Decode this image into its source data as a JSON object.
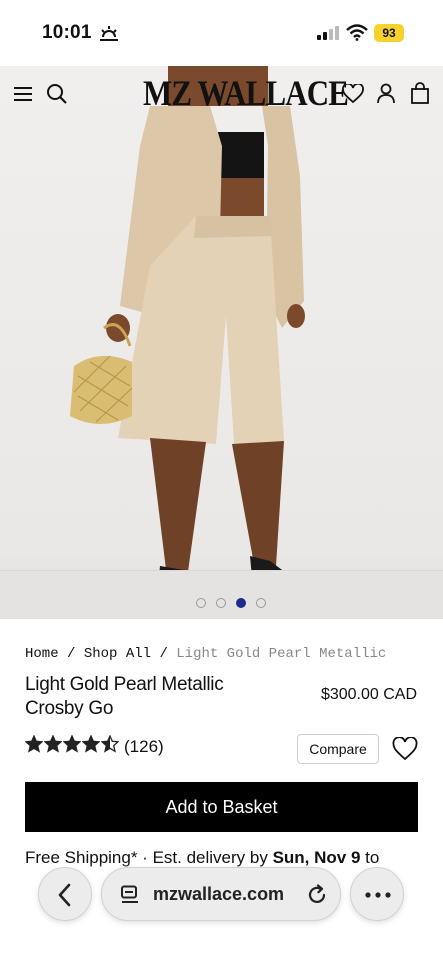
{
  "status_bar": {
    "time": "10:01",
    "battery": "93"
  },
  "header": {
    "logo": "MZ WALLACE",
    "icons": [
      "menu-icon",
      "search-icon",
      "heart-icon",
      "account-icon",
      "bag-icon"
    ]
  },
  "gallery": {
    "dots": 4,
    "active_index": 2
  },
  "breadcrumb": {
    "home": "Home",
    "sep1": " / ",
    "shop_all": "Shop All",
    "sep2": " / ",
    "current": "Light Gold Pearl Metallic"
  },
  "product": {
    "title_line1": "Light Gold Pearl Metallic",
    "title_line2": "Crosby Go",
    "price": "$300.00 CAD",
    "rating": 4.5,
    "review_count": "(126)",
    "compare_label": "Compare",
    "add_to_basket_label": "Add to Basket"
  },
  "shipping": {
    "prefix": "Free Shipping* · Est. delivery by ",
    "date": "Sun, Nov 9",
    "suffix": " to"
  },
  "browser": {
    "url": "mzwallace.com"
  },
  "colors": {
    "accent_dot": "#1f2a8a",
    "button_bg": "#000000",
    "battery": "#f5d32c"
  }
}
